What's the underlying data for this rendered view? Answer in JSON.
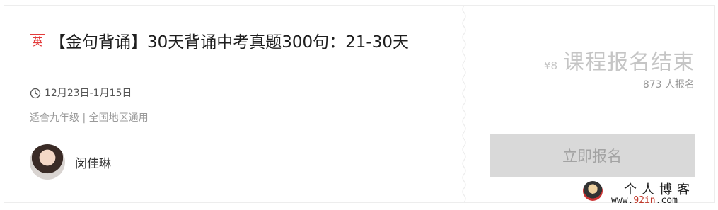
{
  "course": {
    "subject_badge": "英",
    "title": "【金句背诵】30天背诵中考真题300句：21-30天",
    "date_range": "12月23日-1月15日",
    "meta": "适合九年级 | 全国地区通用",
    "teacher": "闵佳琳"
  },
  "signup": {
    "price": "¥8",
    "status": "课程报名结束",
    "enroll_count": "873 人报名",
    "button_label": "立即报名"
  },
  "watermark": {
    "title": "个人博客",
    "url_prefix": "www.",
    "url_accent": "92in",
    "url_suffix": ".com"
  },
  "colors": {
    "badge": "#e33c3c",
    "button_bg": "#d9d9d9",
    "button_text": "#a3a3a3",
    "status_text": "#c5c5c5"
  },
  "icons": [
    "clock-icon"
  ]
}
